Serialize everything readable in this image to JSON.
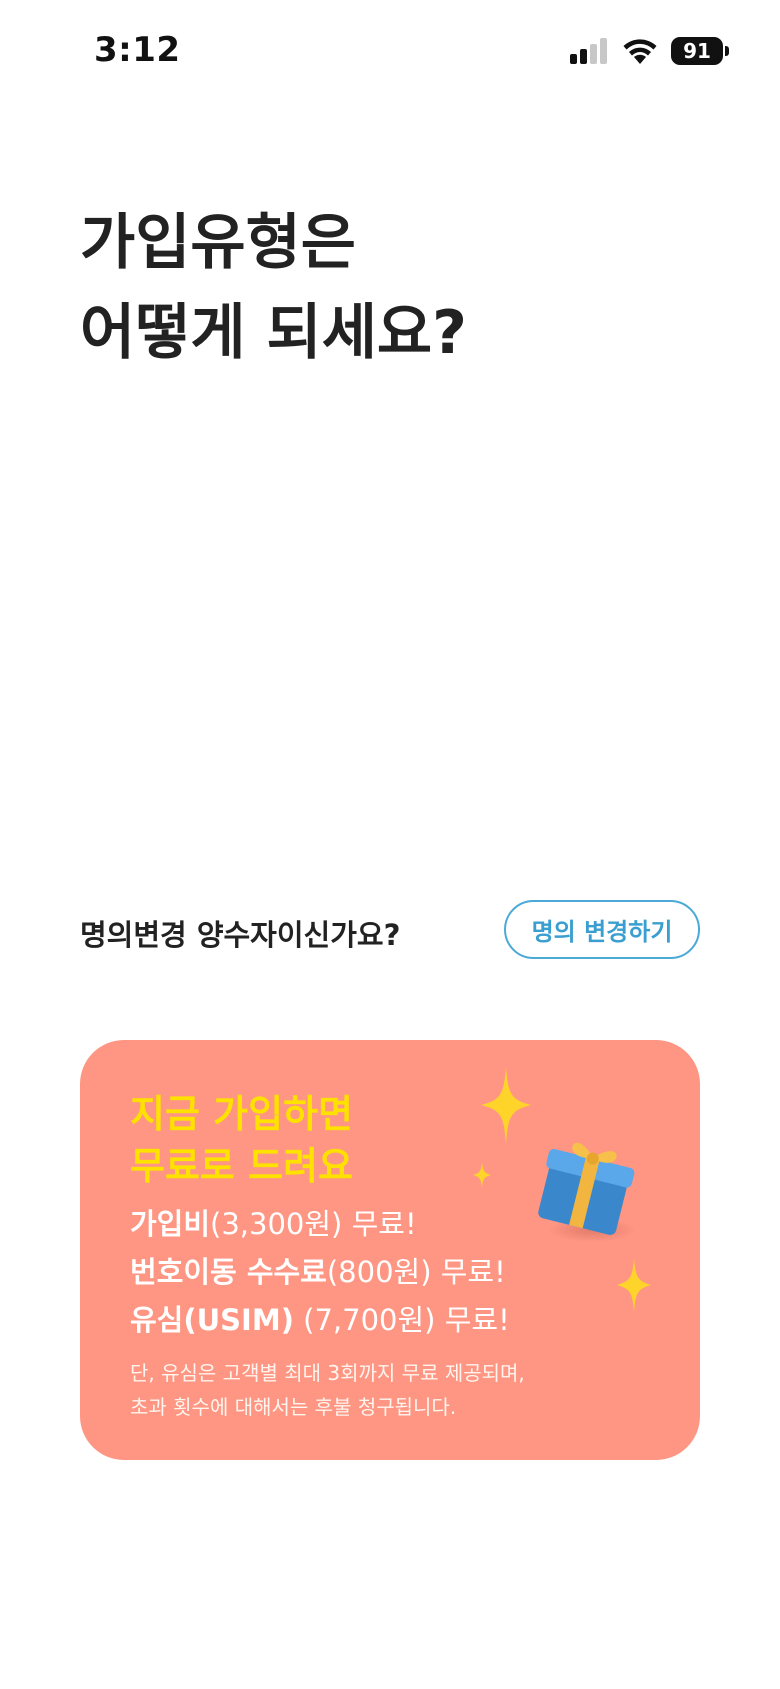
{
  "status": {
    "time": "3:12",
    "battery": "91",
    "icons": [
      "signal-icon",
      "wifi-icon",
      "battery-icon"
    ]
  },
  "title": {
    "line1": "가입유형은",
    "line2": "어떻게 되세요?"
  },
  "transfer": {
    "question": "명의변경 양수자이신가요?",
    "button_label": "명의 변경하기"
  },
  "promo": {
    "headline_line1": "지금 가입하면",
    "headline_line2": "무료로 드려요",
    "benefits": [
      {
        "strong": "가입비",
        "rest": "(3,300원) 무료!"
      },
      {
        "strong": "번호이동 수수료",
        "rest": "(800원) 무료!"
      },
      {
        "strong": "유심(USIM)",
        "rest": " (7,700원) 무료!"
      }
    ],
    "note_line1": "단, 유심은 고객별 최대 3회까지 무료 제공되며,",
    "note_line2": "초과 횟수에 대해서는 후불 청구됩니다.",
    "icons": [
      "sparkle-icon",
      "gift-icon"
    ]
  },
  "colors": {
    "card": "#fe9683",
    "headline": "#ffe100",
    "button_border": "#4aa9d6",
    "sparkle": "#ffd42a",
    "gift_box": "#3f8fd6",
    "gift_ribbon": "#f2b640"
  }
}
